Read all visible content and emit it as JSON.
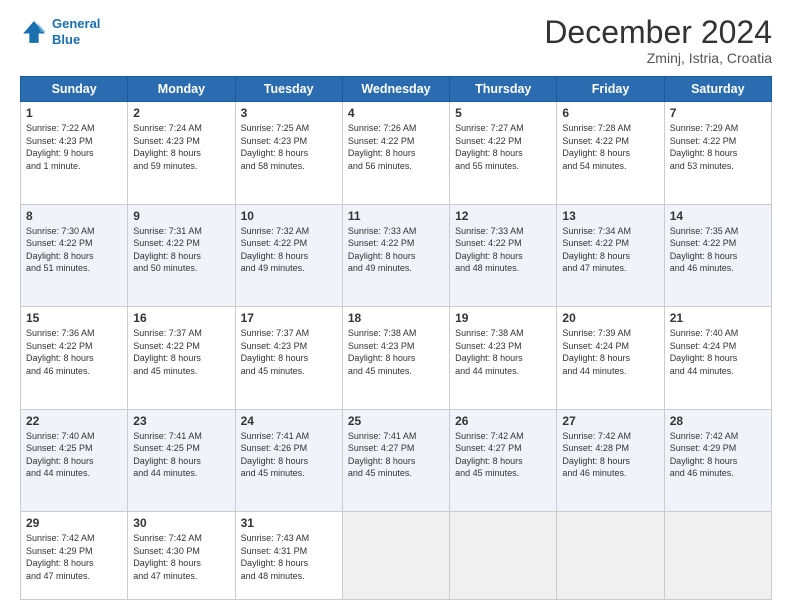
{
  "logo": {
    "line1": "General",
    "line2": "Blue"
  },
  "title": "December 2024",
  "location": "Zminj, Istria, Croatia",
  "days_of_week": [
    "Sunday",
    "Monday",
    "Tuesday",
    "Wednesday",
    "Thursday",
    "Friday",
    "Saturday"
  ],
  "weeks": [
    [
      {
        "day": "1",
        "info": "Sunrise: 7:22 AM\nSunset: 4:23 PM\nDaylight: 9 hours\nand 1 minute."
      },
      {
        "day": "2",
        "info": "Sunrise: 7:24 AM\nSunset: 4:23 PM\nDaylight: 8 hours\nand 59 minutes."
      },
      {
        "day": "3",
        "info": "Sunrise: 7:25 AM\nSunset: 4:23 PM\nDaylight: 8 hours\nand 58 minutes."
      },
      {
        "day": "4",
        "info": "Sunrise: 7:26 AM\nSunset: 4:22 PM\nDaylight: 8 hours\nand 56 minutes."
      },
      {
        "day": "5",
        "info": "Sunrise: 7:27 AM\nSunset: 4:22 PM\nDaylight: 8 hours\nand 55 minutes."
      },
      {
        "day": "6",
        "info": "Sunrise: 7:28 AM\nSunset: 4:22 PM\nDaylight: 8 hours\nand 54 minutes."
      },
      {
        "day": "7",
        "info": "Sunrise: 7:29 AM\nSunset: 4:22 PM\nDaylight: 8 hours\nand 53 minutes."
      }
    ],
    [
      {
        "day": "8",
        "info": "Sunrise: 7:30 AM\nSunset: 4:22 PM\nDaylight: 8 hours\nand 51 minutes."
      },
      {
        "day": "9",
        "info": "Sunrise: 7:31 AM\nSunset: 4:22 PM\nDaylight: 8 hours\nand 50 minutes."
      },
      {
        "day": "10",
        "info": "Sunrise: 7:32 AM\nSunset: 4:22 PM\nDaylight: 8 hours\nand 49 minutes."
      },
      {
        "day": "11",
        "info": "Sunrise: 7:33 AM\nSunset: 4:22 PM\nDaylight: 8 hours\nand 49 minutes."
      },
      {
        "day": "12",
        "info": "Sunrise: 7:33 AM\nSunset: 4:22 PM\nDaylight: 8 hours\nand 48 minutes."
      },
      {
        "day": "13",
        "info": "Sunrise: 7:34 AM\nSunset: 4:22 PM\nDaylight: 8 hours\nand 47 minutes."
      },
      {
        "day": "14",
        "info": "Sunrise: 7:35 AM\nSunset: 4:22 PM\nDaylight: 8 hours\nand 46 minutes."
      }
    ],
    [
      {
        "day": "15",
        "info": "Sunrise: 7:36 AM\nSunset: 4:22 PM\nDaylight: 8 hours\nand 46 minutes."
      },
      {
        "day": "16",
        "info": "Sunrise: 7:37 AM\nSunset: 4:22 PM\nDaylight: 8 hours\nand 45 minutes."
      },
      {
        "day": "17",
        "info": "Sunrise: 7:37 AM\nSunset: 4:23 PM\nDaylight: 8 hours\nand 45 minutes."
      },
      {
        "day": "18",
        "info": "Sunrise: 7:38 AM\nSunset: 4:23 PM\nDaylight: 8 hours\nand 45 minutes."
      },
      {
        "day": "19",
        "info": "Sunrise: 7:38 AM\nSunset: 4:23 PM\nDaylight: 8 hours\nand 44 minutes."
      },
      {
        "day": "20",
        "info": "Sunrise: 7:39 AM\nSunset: 4:24 PM\nDaylight: 8 hours\nand 44 minutes."
      },
      {
        "day": "21",
        "info": "Sunrise: 7:40 AM\nSunset: 4:24 PM\nDaylight: 8 hours\nand 44 minutes."
      }
    ],
    [
      {
        "day": "22",
        "info": "Sunrise: 7:40 AM\nSunset: 4:25 PM\nDaylight: 8 hours\nand 44 minutes."
      },
      {
        "day": "23",
        "info": "Sunrise: 7:41 AM\nSunset: 4:25 PM\nDaylight: 8 hours\nand 44 minutes."
      },
      {
        "day": "24",
        "info": "Sunrise: 7:41 AM\nSunset: 4:26 PM\nDaylight: 8 hours\nand 45 minutes."
      },
      {
        "day": "25",
        "info": "Sunrise: 7:41 AM\nSunset: 4:27 PM\nDaylight: 8 hours\nand 45 minutes."
      },
      {
        "day": "26",
        "info": "Sunrise: 7:42 AM\nSunset: 4:27 PM\nDaylight: 8 hours\nand 45 minutes."
      },
      {
        "day": "27",
        "info": "Sunrise: 7:42 AM\nSunset: 4:28 PM\nDaylight: 8 hours\nand 46 minutes."
      },
      {
        "day": "28",
        "info": "Sunrise: 7:42 AM\nSunset: 4:29 PM\nDaylight: 8 hours\nand 46 minutes."
      }
    ],
    [
      {
        "day": "29",
        "info": "Sunrise: 7:42 AM\nSunset: 4:29 PM\nDaylight: 8 hours\nand 47 minutes."
      },
      {
        "day": "30",
        "info": "Sunrise: 7:42 AM\nSunset: 4:30 PM\nDaylight: 8 hours\nand 47 minutes."
      },
      {
        "day": "31",
        "info": "Sunrise: 7:43 AM\nSunset: 4:31 PM\nDaylight: 8 hours\nand 48 minutes."
      },
      null,
      null,
      null,
      null
    ]
  ]
}
